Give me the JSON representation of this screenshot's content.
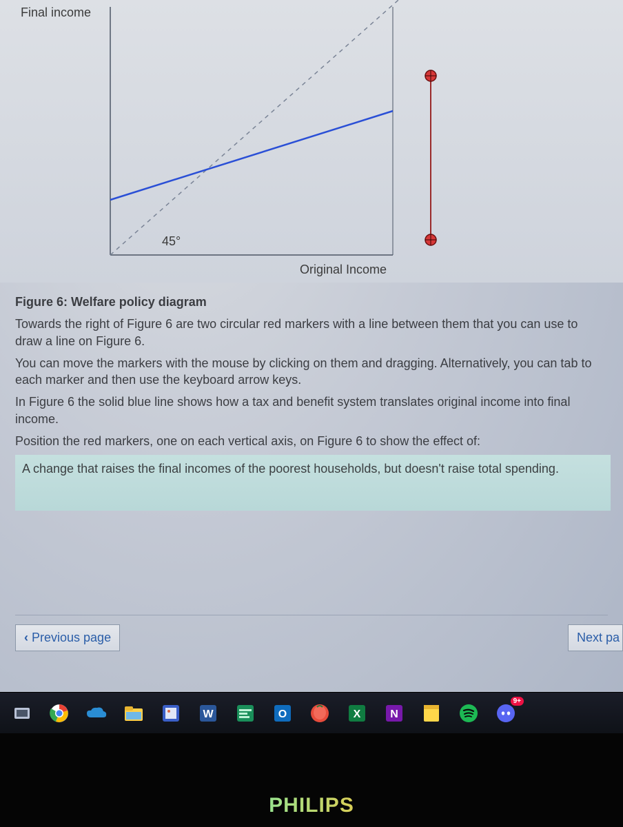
{
  "chart_data": {
    "type": "line",
    "title": "Figure 6: Welfare policy diagram",
    "xlabel": "Original Income",
    "ylabel": "Final income",
    "annotations": [
      "45°"
    ],
    "series": [
      {
        "name": "45-degree-reference",
        "style": "dashed",
        "color": "#7a8496",
        "points": [
          [
            0,
            0
          ],
          [
            100,
            100
          ]
        ]
      },
      {
        "name": "tax-benefit-line",
        "style": "solid",
        "color": "#2a4fd6",
        "points": [
          [
            0,
            22
          ],
          [
            100,
            58
          ]
        ]
      }
    ],
    "markers": [
      {
        "name": "red-marker-top",
        "x": 106,
        "y": 80
      },
      {
        "name": "red-marker-bottom",
        "x": 106,
        "y": 8
      }
    ],
    "xlim": [
      0,
      100
    ],
    "ylim": [
      0,
      100
    ]
  },
  "labels": {
    "y": "Final income",
    "x": "Original Income",
    "angle": "45°"
  },
  "caption": "Figure 6: Welfare policy diagram",
  "para1": "Towards the right of Figure 6 are two circular red markers with a line between them that you can use to draw a line on Figure 6.",
  "para2": "You can move the markers with the mouse by clicking on them and dragging. Alternatively, you can tab to each marker and then use the keyboard arrow keys.",
  "para3": "In Figure 6 the solid blue line shows how a tax and benefit system translates original income into final income.",
  "para4": "Position the red markers, one on each vertical axis, on Figure 6 to show the effect of:",
  "quote": "A change that raises the final incomes of the poorest households, but doesn't raise total spending.",
  "nav": {
    "prev": "Previous page",
    "next": "Next pa"
  },
  "taskbar": {
    "icons": [
      "task-view-icon",
      "chrome-icon",
      "onedrive-icon",
      "file-explorer-icon",
      "snip-icon",
      "word-icon",
      "code-icon",
      "outlook-icon",
      "generic-app-icon",
      "excel-icon",
      "onenote-icon",
      "notes-icon",
      "spotify-icon",
      "discord-icon"
    ],
    "badge": "9+"
  },
  "monitor": "PHILIPS"
}
